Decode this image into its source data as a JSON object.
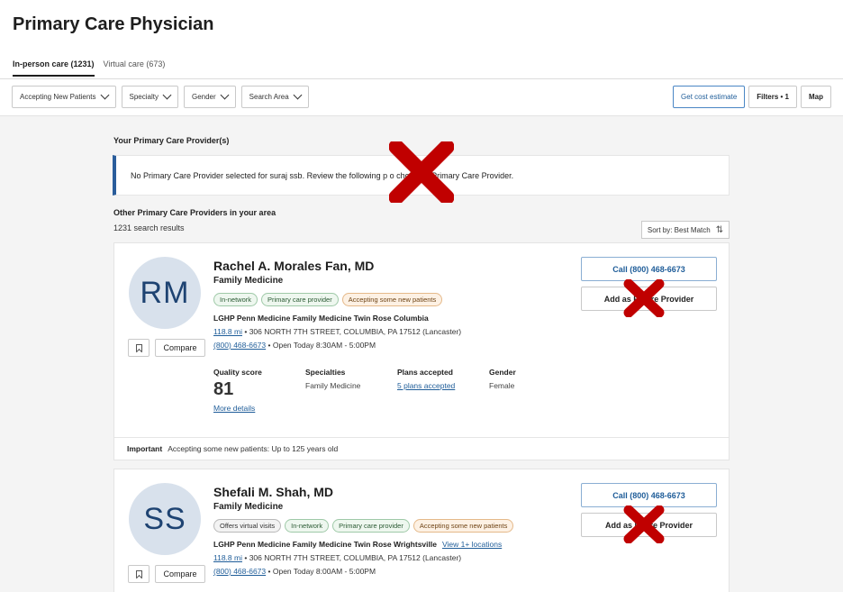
{
  "page": {
    "title": "Primary Care Physician"
  },
  "tabs": [
    {
      "label": "In-person care (1231)",
      "active": true
    },
    {
      "label": "Virtual care (673)",
      "active": false
    }
  ],
  "filters": [
    {
      "label": "Accepting New Patients"
    },
    {
      "label": "Specialty"
    },
    {
      "label": "Gender"
    },
    {
      "label": "Search Area"
    }
  ],
  "actions": {
    "cost_estimate": "Get cost estimate",
    "filters": "Filters • 1",
    "map": "Map"
  },
  "your_pcp": {
    "heading": "Your Primary Care Provider(s)",
    "notice": "No Primary Care Provider selected for suraj ssb. Review the following p        o choose a Primary Care Provider."
  },
  "others": {
    "heading": "Other Primary Care Providers in your area",
    "count": "1231 search results",
    "sort_label": "Sort by: Best Match"
  },
  "providers": [
    {
      "initials": "RM",
      "name": "Rachel A. Morales Fan, MD",
      "specialty": "Family Medicine",
      "badges": [
        "In-network",
        "Primary care provider",
        "Accepting some new patients"
      ],
      "practice": "LGHP Penn Medicine Family Medicine Twin Rose Columbia",
      "distance": "118.8 mi",
      "address": "306 NORTH 7TH STREET, COLUMBIA, PA 17512 (Lancaster)",
      "phone": "(800) 468-6673",
      "hours": "Open Today 8:30AM - 5:00PM",
      "quality_label": "Quality score",
      "quality_score": "81",
      "more_details": "More details",
      "specialties_label": "Specialties",
      "specialties": "Family Medicine",
      "plans_label": "Plans accepted",
      "plans": "5 plans accepted",
      "gender_label": "Gender",
      "gender": "Female",
      "call_label": "Call (800) 468-6673",
      "add_label": "Add as Pri         are Provider",
      "compare_label": "Compare",
      "important_label": "Important",
      "important_text": "Accepting some new patients: Up to 125 years old"
    },
    {
      "initials": "SS",
      "name": "Shefali M. Shah, MD",
      "specialty": "Family Medicine",
      "badges": [
        "Offers virtual visits",
        "In-network",
        "Primary care provider",
        "Accepting some new patients"
      ],
      "practice": "LGHP Penn Medicine Family Medicine Twin Rose Wrightsville",
      "locations_link": "View 1+ locations",
      "distance": "118.8 mi",
      "address": "306 NORTH 7TH STREET, COLUMBIA, PA 17512 (Lancaster)",
      "phone": "(800) 468-6673",
      "hours": "Open Today 8:00AM - 5:00PM",
      "call_label": "Call (800) 468-6673",
      "add_label": "Add as Pr         are Provider",
      "compare_label": "Compare"
    }
  ],
  "colors": {
    "accent": "#1f5d99",
    "redaction": "#c00000"
  }
}
